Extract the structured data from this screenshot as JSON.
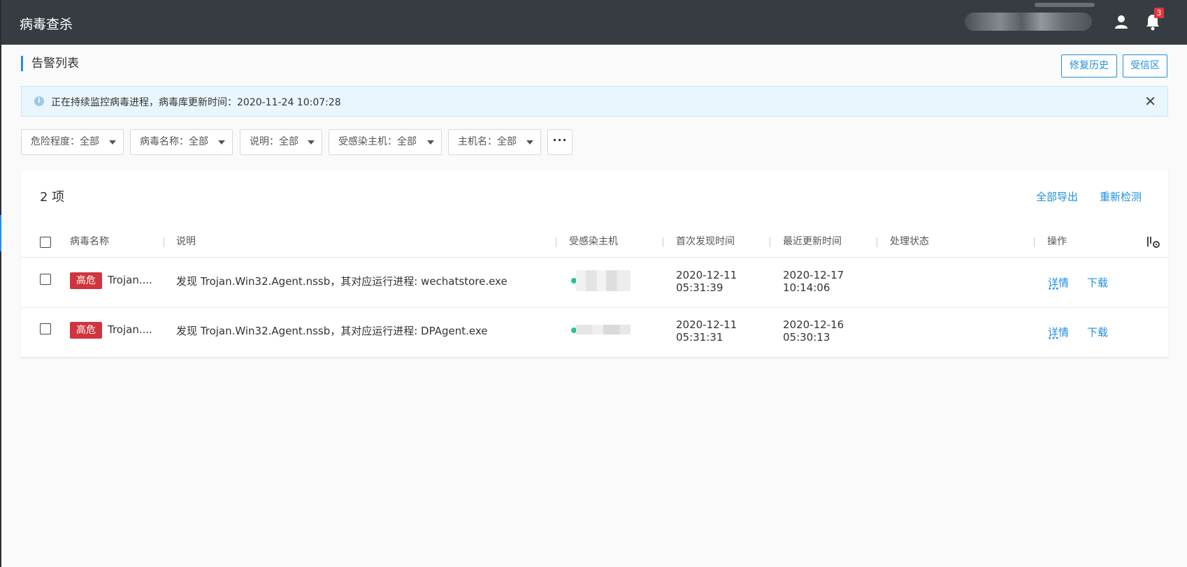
{
  "header": {
    "title": "病毒查杀",
    "notification_count": "3"
  },
  "section": {
    "title": "告警列表",
    "repair_history_button": "修复历史",
    "trust_zone_button": "受信区"
  },
  "info_bar": {
    "text": "正在持续监控病毒进程，病毒库更新时间：2020-11-24 10:07:28"
  },
  "filters": [
    {
      "label": "危险程度：全部"
    },
    {
      "label": "病毒名称：全部"
    },
    {
      "label": "说明：全部"
    },
    {
      "label": "受感染主机：全部"
    },
    {
      "label": "主机名：全部"
    }
  ],
  "table": {
    "count_text": "2 项",
    "export_all": "全部导出",
    "recheck": "重新检测",
    "columns": {
      "virus_name": "病毒名称",
      "description": "说明",
      "infected_host": "受感染主机",
      "first_seen": "首次发现时间",
      "last_updated": "最近更新时间",
      "status": "处理状态",
      "actions": "操作"
    },
    "rows": [
      {
        "level": "高危",
        "virus_name": "Trojan....",
        "description": "发现 Trojan.Win32.Agent.nssb，其对应运行进程: wechatstore.exe",
        "first_seen_date": "2020-12-11",
        "first_seen_time": "05:31:39",
        "last_updated_date": "2020-12-17",
        "last_updated_time": "10:14:06",
        "status": "",
        "detail": "详情",
        "download": "下载"
      },
      {
        "level": "高危",
        "virus_name": "Trojan....",
        "description": "发现 Trojan.Win32.Agent.nssb，其对应运行进程: DPAgent.exe",
        "first_seen_date": "2020-12-11",
        "first_seen_time": "05:31:31",
        "last_updated_date": "2020-12-16",
        "last_updated_time": "05:30:13",
        "status": "",
        "detail": "详情",
        "download": "下载"
      }
    ]
  },
  "colors": {
    "topbar": "#373c43",
    "accent": "#1f8fe0",
    "danger": "#d0353d",
    "online": "#2cc28b"
  },
  "icons": [
    "user-icon",
    "bell-icon",
    "info-icon",
    "close-icon",
    "chevron-down-icon",
    "more-icon",
    "column-settings-icon"
  ]
}
